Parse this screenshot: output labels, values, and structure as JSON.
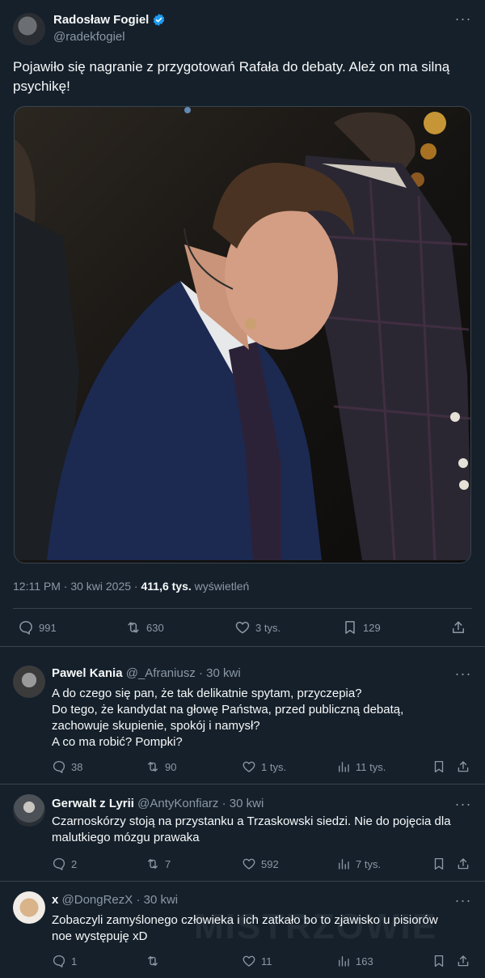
{
  "post": {
    "author_name": "Radosław Fogiel",
    "author_handle": "@radekfogiel",
    "text": "Pojawiło się nagranie z przygotowań Rafała do debaty. Ależ on ma silną psychikę!",
    "time": "12:11 PM · 30 kwi 2025 · ",
    "views_count": "411,6 tys.",
    "views_label": "wyświetleń",
    "actions": {
      "replies": "991",
      "reposts": "630",
      "likes": "3 tys.",
      "bookmarks": "129"
    }
  },
  "replies": [
    {
      "name": "Pawel Kania",
      "handle": "@_Afraniusz · 30 kwi",
      "lines": [
        "A do czego się pan, że tak delikatnie spytam, przyczepia?",
        "Do tego, że kandydat na głowę Państwa, przed publiczną debatą,",
        "zachowuje skupienie, spokój i namysł?",
        "A co ma robić? Pompki?"
      ],
      "replies": "38",
      "reposts": "90",
      "likes": "1 tys.",
      "views": "11 tys."
    },
    {
      "name": "Gerwalt z Lyrii",
      "handle": "@AntyKonfiarz · 30 kwi",
      "lines": [
        "Czarnoskórzy stoją na przystanku a Trzaskowski siedzi. Nie do pojęcia dla",
        "malutkiego mózgu prawaka"
      ],
      "replies": "2",
      "reposts": "7",
      "likes": "592",
      "views": "7 tys."
    },
    {
      "name": "x",
      "handle": "@DongRezX · 30 kwi",
      "lines": [
        "Zobaczyli zamyślonego człowieka i ich zatkało bo to zjawisko u pisiorów",
        "noe występuję xD"
      ],
      "replies": "1",
      "reposts": "",
      "likes": "11",
      "views": "163"
    }
  ],
  "colors": {
    "background": "#15202b",
    "text": "#f7f9f9",
    "muted": "#8b98a5",
    "verified": "#1d9bf0",
    "divider": "#38444d"
  },
  "watermark": "MISTRZOWIE"
}
